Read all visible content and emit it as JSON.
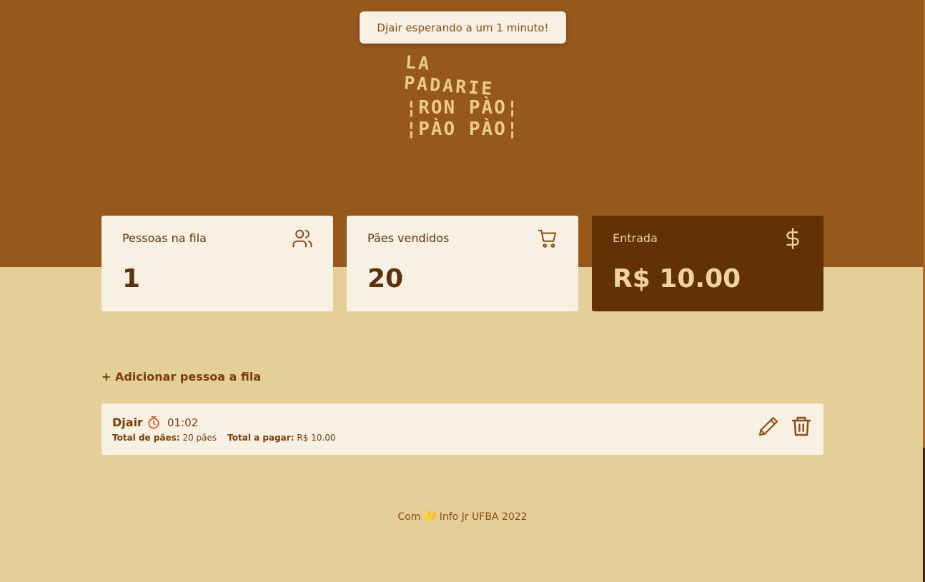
{
  "toast": {
    "message": "Djair esperando a um 1 minuto!"
  },
  "logo": {
    "line1": "LA PADARIE",
    "line2": "¦RON PÀO¦",
    "line3": "¦PÀO PÀO¦"
  },
  "cards": [
    {
      "title": "Pessoas na fila",
      "value": "1",
      "icon": "users-icon"
    },
    {
      "title": "Pães vendidos",
      "value": "20",
      "icon": "cart-icon"
    },
    {
      "title": "Entrada",
      "value": "R$ 10.00",
      "icon": "dollar-icon"
    }
  ],
  "add_person": {
    "label": "+ Adicionar pessoa a fila"
  },
  "queue": [
    {
      "name": "Djair",
      "timer": "01:02",
      "bread_label": "Total de pães:",
      "bread_value": "20 pães",
      "pay_label": "Total a pagar:",
      "pay_value": "R$ 10.00"
    }
  ],
  "footer": {
    "prefix": "Com",
    "heart": "💛",
    "suffix": "Info Jr UFBA 2022"
  },
  "colors": {
    "brown_band": "#97581b",
    "background": "#e3cf97",
    "card": "#f8f1e3",
    "dark_card": "#623104",
    "text": "#5c3209",
    "danger": "#e0481e"
  }
}
